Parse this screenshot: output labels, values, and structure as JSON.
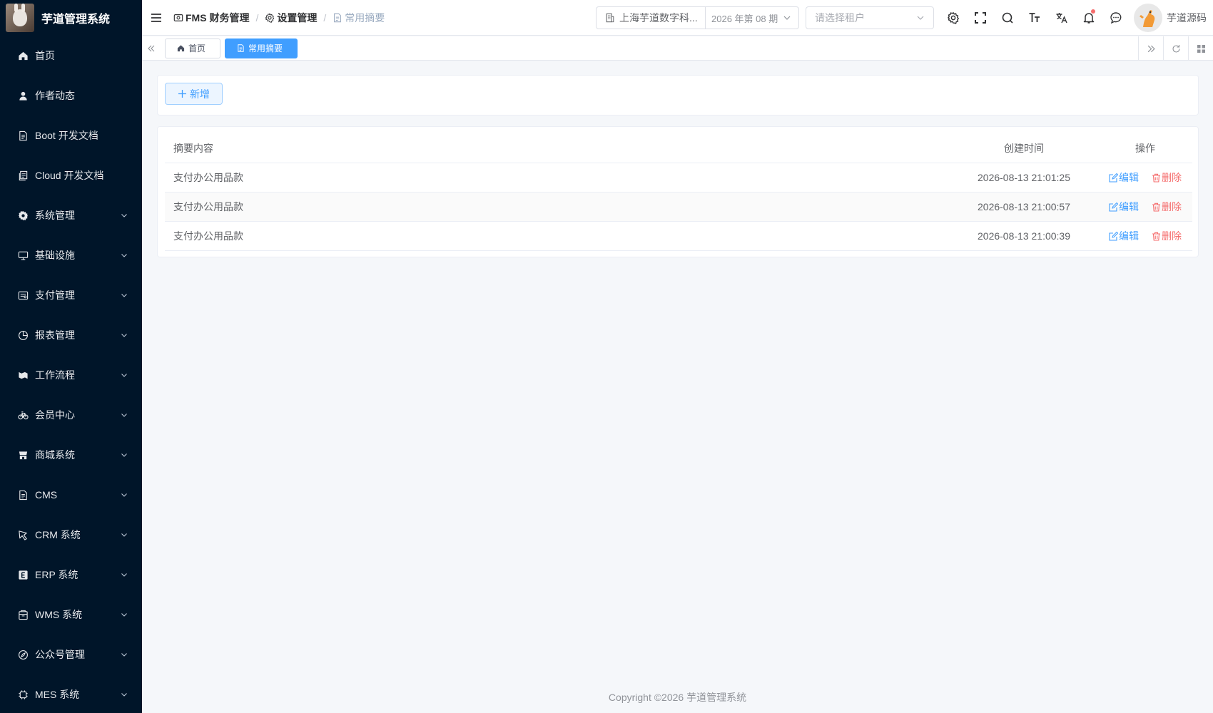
{
  "app": {
    "title": "芋道管理系统"
  },
  "sidebar": {
    "items": [
      {
        "label": "首页",
        "icon": "home-icon",
        "has_children": false
      },
      {
        "label": "作者动态",
        "icon": "user-icon",
        "has_children": false
      },
      {
        "label": "Boot 开发文档",
        "icon": "document-icon",
        "has_children": false
      },
      {
        "label": "Cloud 开发文档",
        "icon": "documents-icon",
        "has_children": false
      },
      {
        "label": "系统管理",
        "icon": "gear-icon",
        "has_children": true
      },
      {
        "label": "基础设施",
        "icon": "monitor-icon",
        "has_children": true
      },
      {
        "label": "支付管理",
        "icon": "payment-icon",
        "has_children": true
      },
      {
        "label": "报表管理",
        "icon": "pie-chart-icon",
        "has_children": true
      },
      {
        "label": "工作流程",
        "icon": "workflow-icon",
        "has_children": true
      },
      {
        "label": "会员中心",
        "icon": "bicycle-icon",
        "has_children": true
      },
      {
        "label": "商城系统",
        "icon": "shop-icon",
        "has_children": true
      },
      {
        "label": "CMS",
        "icon": "document-icon",
        "has_children": true
      },
      {
        "label": "CRM 系统",
        "icon": "crm-icon",
        "has_children": true
      },
      {
        "label": "ERP 系统",
        "icon": "erp-icon",
        "has_children": true
      },
      {
        "label": "WMS 系统",
        "icon": "warehouse-icon",
        "has_children": true
      },
      {
        "label": "公众号管理",
        "icon": "compass-icon",
        "has_children": true
      },
      {
        "label": "MES 系统",
        "icon": "chip-icon",
        "has_children": true
      }
    ]
  },
  "header": {
    "breadcrumb": [
      {
        "label": "FMS 财务管理",
        "icon": "finance-icon"
      },
      {
        "label": "设置管理",
        "icon": "gear-icon"
      },
      {
        "label": "常用摘要",
        "icon": "document-icon"
      }
    ],
    "company": "上海芋道数字科...",
    "period": "2026 年第 08 期",
    "tenant_placeholder": "请选择租户",
    "user_name": "芋道源码"
  },
  "tags": {
    "items": [
      {
        "label": "首页",
        "icon": "home-icon",
        "active": false
      },
      {
        "label": "常用摘要",
        "icon": "document-icon",
        "active": true
      }
    ]
  },
  "toolbar": {
    "add_label": "新增"
  },
  "table": {
    "columns": [
      "摘要内容",
      "创建时间",
      "操作"
    ],
    "rows": [
      {
        "content": "支付办公用品款",
        "created": "2026-08-13 21:01:25"
      },
      {
        "content": "支付办公用品款",
        "created": "2026-08-13 21:00:57"
      },
      {
        "content": "支付办公用品款",
        "created": "2026-08-13 21:00:39"
      }
    ],
    "edit_label": "编辑",
    "delete_label": "删除"
  },
  "footer": {
    "copyright": "Copyright ©2026 芋道管理系统"
  },
  "colors": {
    "sidebar_bg": "#001529",
    "primary": "#409eff",
    "danger": "#f56c6c"
  }
}
